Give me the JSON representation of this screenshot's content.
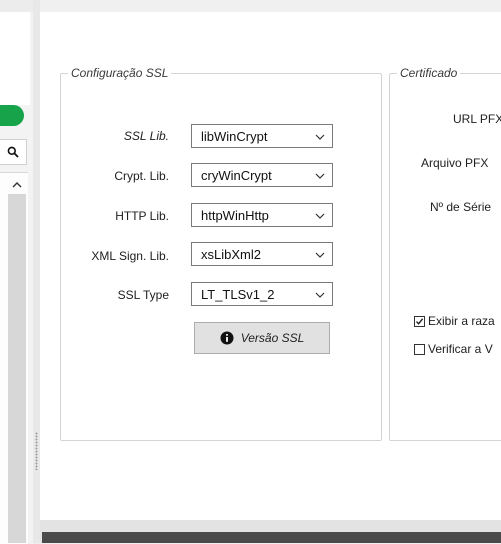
{
  "ssl_config": {
    "title": "Configuração SSL",
    "rows": [
      {
        "label": "SSL Lib.",
        "value": "libWinCrypt"
      },
      {
        "label": "Crypt. Lib.",
        "value": "cryWinCrypt"
      },
      {
        "label": "HTTP Lib.",
        "value": "httpWinHttp"
      },
      {
        "label": "XML Sign. Lib.",
        "value": "xsLibXml2"
      },
      {
        "label": "SSL Type",
        "value": "LT_TLSv1_2"
      }
    ],
    "version_button": "Versão SSL"
  },
  "certificate": {
    "title": "Certificado",
    "url_pfx": "URL PFX",
    "arquivo_pfx": "Arquivo PFX",
    "numero_serie": "Nº de Série",
    "exibir_razao": "Exibir a raza",
    "verificar_validade": "Verificar a V",
    "exibir_razao_checked": true,
    "verificar_validade_checked": false
  },
  "colors": {
    "accent_green": "#16a34a",
    "panel_bg": "#ffffff",
    "window_bg": "#f0f0f0"
  },
  "icons": {
    "search": "search-icon",
    "scroll_up": "chevron-up-icon",
    "dropdown": "chevron-down-icon",
    "info": "info-icon",
    "checkmark": "checkmark-icon"
  }
}
